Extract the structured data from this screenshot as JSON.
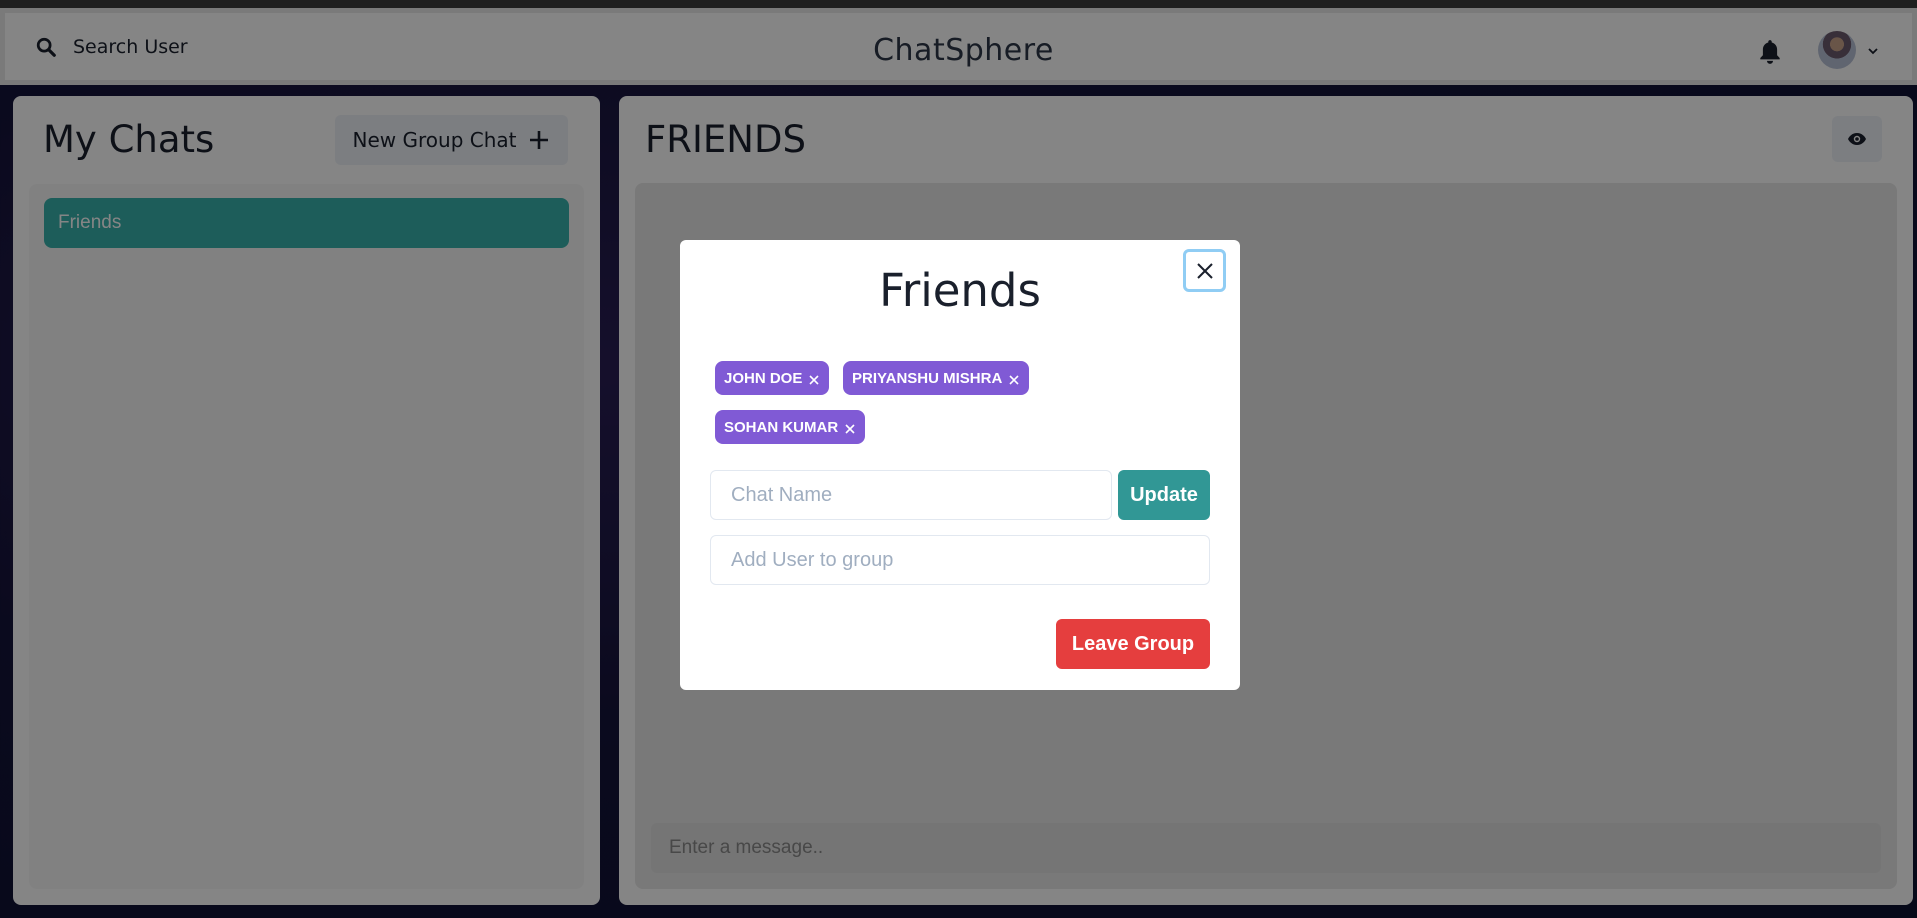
{
  "header": {
    "search_label": "Search User",
    "app_title": "ChatSphere"
  },
  "left_panel": {
    "title": "My Chats",
    "new_group_label": "New Group Chat",
    "chats": [
      {
        "name": "Friends",
        "selected": true
      }
    ]
  },
  "right_panel": {
    "chat_title": "FRIENDS",
    "message_placeholder": "Enter a message.."
  },
  "modal": {
    "title": "Friends",
    "members": [
      {
        "name": "JOHN DOE"
      },
      {
        "name": "PRIYANSHU MISHRA"
      },
      {
        "name": "SOHAN KUMAR"
      }
    ],
    "chat_name_placeholder": "Chat Name",
    "update_label": "Update",
    "add_user_placeholder": "Add User to group",
    "leave_label": "Leave Group"
  },
  "colors": {
    "accent_teal": "#38b2ac",
    "badge_purple": "#805ad5",
    "update_teal": "#319795",
    "danger_red": "#e53e3e"
  },
  "icons": [
    "search-icon",
    "bell-icon",
    "chevron-down-icon",
    "plus-icon",
    "eye-icon",
    "close-icon"
  ]
}
